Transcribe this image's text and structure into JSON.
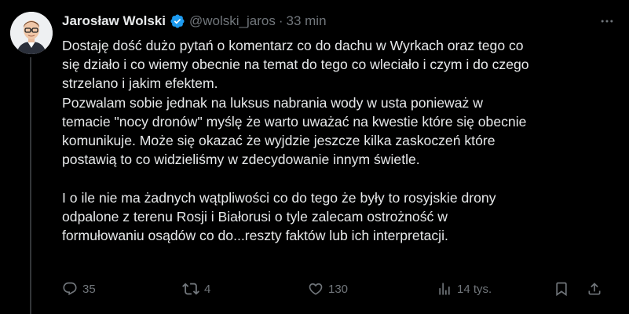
{
  "author": {
    "display_name": "Jarosław Wolski",
    "handle": "@wolski_jaros",
    "separator": "·",
    "timestamp": "33 min",
    "verified_icon": "verified-badge-icon",
    "accent_color": "#1d9bf0"
  },
  "body": {
    "lines": [
      "Dostaję dość dużo pytań o komentarz co do dachu w Wyrkach oraz tego co",
      "się działo i co wiemy obecnie na temat do tego co wleciało i czym i do czego",
      "strzelano i jakim efektem.",
      "Pozwalam sobie jednak na luksus nabrania wody w usta ponieważ w",
      "temacie \"nocy dronów\" myślę że warto uważać na kwestie które się obecnie",
      "komunikuje. Może się okazać że wyjdzie jeszcze kilka zaskoczeń które",
      "postawią to co widzieliśmy w zdecydowanie innym świetle.",
      "I o ile nie ma żadnych wątpliwości co do tego że były to rosyjskie drony",
      "odpalone z terenu Rosji i Białorusi o tyle zalecam ostrożność w",
      "formułowaniu osądów co do...reszty faktów lub ich interpretacji."
    ]
  },
  "actions": {
    "replies": "35",
    "reposts": "4",
    "likes": "130",
    "views": "14 tys."
  },
  "colors": {
    "background": "#000000",
    "text": "#e7e9ea",
    "muted": "#71767b"
  }
}
